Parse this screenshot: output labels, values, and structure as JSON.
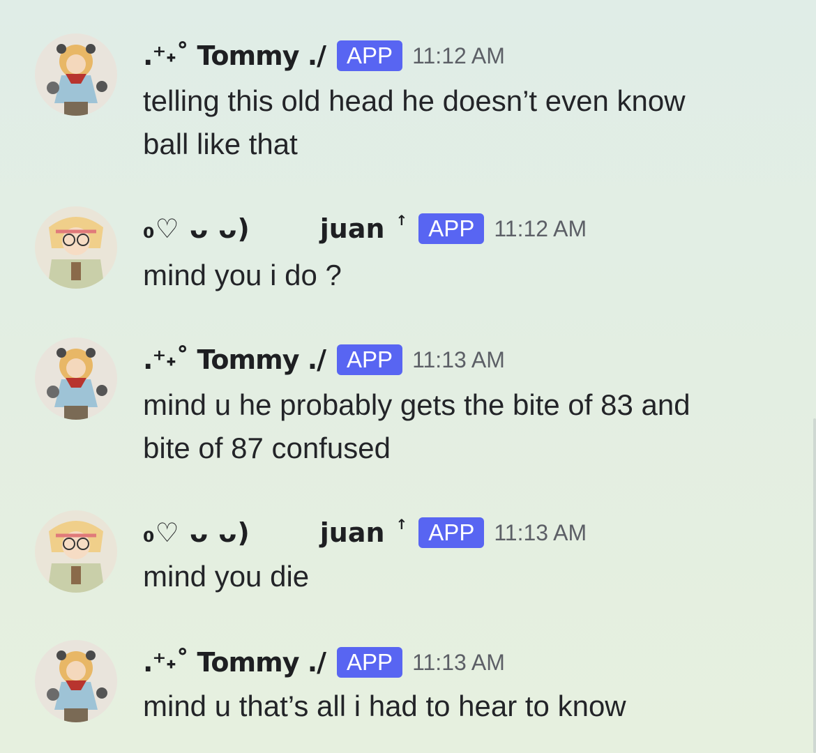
{
  "messages": [
    {
      "author": ".⁺˖˚ Tommy ./",
      "badge": "APP",
      "time": "11:12 AM",
      "lines": [
        "telling this old head he doesn’t even know",
        "ball like that"
      ],
      "avatar": "tommy-avatar"
    },
    {
      "author_kaomoji": "₀♡ ᴗ ᴗ)",
      "author_name": "juan",
      "author_mark": "↑",
      "badge": "APP",
      "time": "11:12 AM",
      "lines": [
        "mind you i do ?"
      ],
      "avatar": "juan-avatar"
    },
    {
      "author": ".⁺˖˚ Tommy ./",
      "badge": "APP",
      "time": "11:13 AM",
      "lines": [
        "mind u he probably gets the bite of 83 and",
        "bite of 87 confused"
      ],
      "avatar": "tommy-avatar"
    },
    {
      "author_kaomoji": "₀♡ ᴗ ᴗ)",
      "author_name": "juan",
      "author_mark": "↑",
      "badge": "APP",
      "time": "11:13 AM",
      "lines": [
        "mind you die"
      ],
      "avatar": "juan-avatar"
    },
    {
      "author": ".⁺˖˚ Tommy ./",
      "badge": "APP",
      "time": "11:13 AM",
      "lines": [
        "mind u that’s all i had to hear to know"
      ],
      "avatar": "tommy-avatar"
    }
  ],
  "colors": {
    "badge": "#5865f2",
    "timestamp": "#5c5f66",
    "text": "#232428"
  }
}
